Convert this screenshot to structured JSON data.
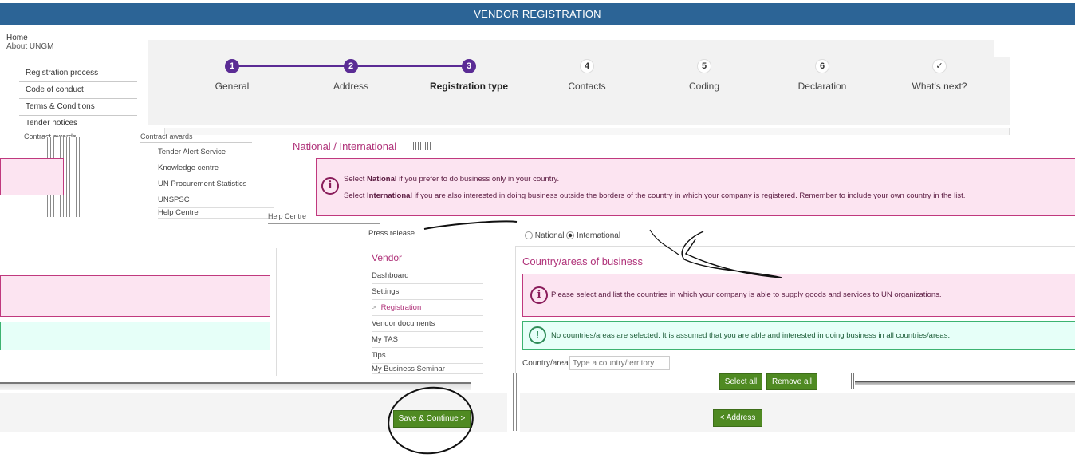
{
  "header": {
    "title": "VENDOR REGISTRATION"
  },
  "left_nav": {
    "top_items": [
      "Home",
      "About UNGM"
    ],
    "sub_items": [
      "Registration process",
      "Code of conduct",
      "Terms & Conditions",
      "Tender notices",
      "Contract awards"
    ],
    "second_items": [
      "Contract awards",
      "Tender Alert Service",
      "Knowledge centre",
      "UN Procurement Statistics",
      "UNSPSC",
      "Help Centre"
    ],
    "overlap_text": "Help Centre"
  },
  "stepper": {
    "steps": [
      {
        "num": "1",
        "label": "General"
      },
      {
        "num": "2",
        "label": "Address"
      },
      {
        "num": "3",
        "label": "Registration type"
      },
      {
        "num": "4",
        "label": "Contacts"
      },
      {
        "num": "5",
        "label": "Coding"
      },
      {
        "num": "6",
        "label": "Declaration"
      },
      {
        "num": "✓",
        "label": "What's next?"
      }
    ],
    "colors": {
      "done": "#5b2c95",
      "todo": "#dddddd"
    }
  },
  "national": {
    "title": "National / International",
    "info_line1_pre": "Select ",
    "info_line1_bold": "National",
    "info_line1_post": " if you prefer to do business only in your country.",
    "info_line2_pre": "Select ",
    "info_line2_bold": "International",
    "info_line2_post": " if you are also interested in doing business outside the borders of the country in which your company is registered. Remember to include your own country in the list.",
    "radio_national": "National",
    "radio_international": "International"
  },
  "right_nav": {
    "press_release": "Press release",
    "vendor_title": "Vendor",
    "items": [
      "Dashboard",
      "Settings",
      "Registration",
      "Vendor documents",
      "My TAS",
      "Tips",
      "My Business Seminar"
    ],
    "active_prefix": ">"
  },
  "country": {
    "title": "Country/areas of business",
    "info_text": "Please select and list the countries in which your company is able to supply goods and services to UN organizations.",
    "ok_text": "No countries/areas are selected. It is assumed that you are able and interested in doing business in all countries/areas.",
    "field_label": "Country/area",
    "field_placeholder": "Type a country/territory",
    "select_all": "Select all",
    "remove_all": "Remove all"
  },
  "buttons": {
    "save_continue": "Save & Continue >",
    "back_address": "< Address"
  },
  "colors": {
    "header": "#2c6496",
    "accent": "#b0337a",
    "button": "#4f8a22"
  }
}
